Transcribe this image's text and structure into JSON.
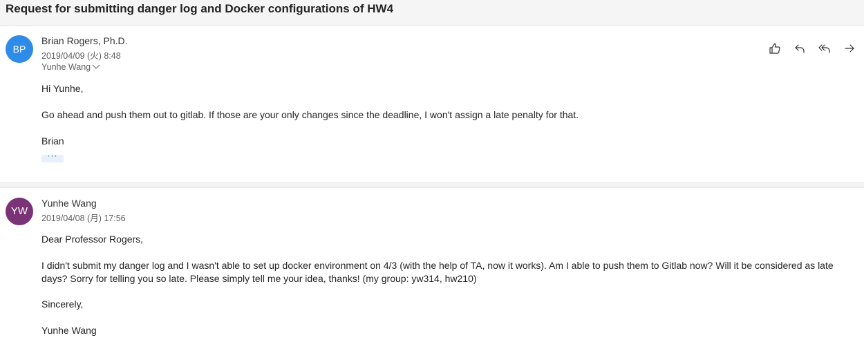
{
  "subject": "Request for submitting danger log and Docker configurations of HW4",
  "actions": {
    "like_icon": "thumbs-up-icon",
    "reply_icon": "reply-icon",
    "reply_all_icon": "reply-all-icon",
    "forward_icon": "forward-icon"
  },
  "messages": [
    {
      "avatar_initials": "BP",
      "avatar_color": "#2e8be8",
      "sender": "Brian Rogers, Ph.D.",
      "date": "2019/04/09 (火) 8:48",
      "recipient": "Yunhe Wang",
      "body": [
        "Hi Yunhe,",
        "Go ahead and push them out to gitlab.  If those are your only changes since the deadline, I won't assign a late penalty for that.",
        "Brian"
      ],
      "ellipsis": "···"
    },
    {
      "avatar_initials": "YW",
      "avatar_color": "#7a3377",
      "sender": "Yunhe Wang",
      "date": "2019/04/08 (月) 17:56",
      "body": [
        "Dear Professor Rogers,",
        "I didn't submit my danger log and I wasn't able to set up docker environment on 4/3 (with the help of TA, now it works). Am I able to push them to Gitlab now? Will it be considered as late days? Sorry for telling you so late. Please simply tell me your idea, thanks! (my group: yw314, hw210)",
        "Sincerely,",
        "Yunhe Wang"
      ]
    }
  ]
}
